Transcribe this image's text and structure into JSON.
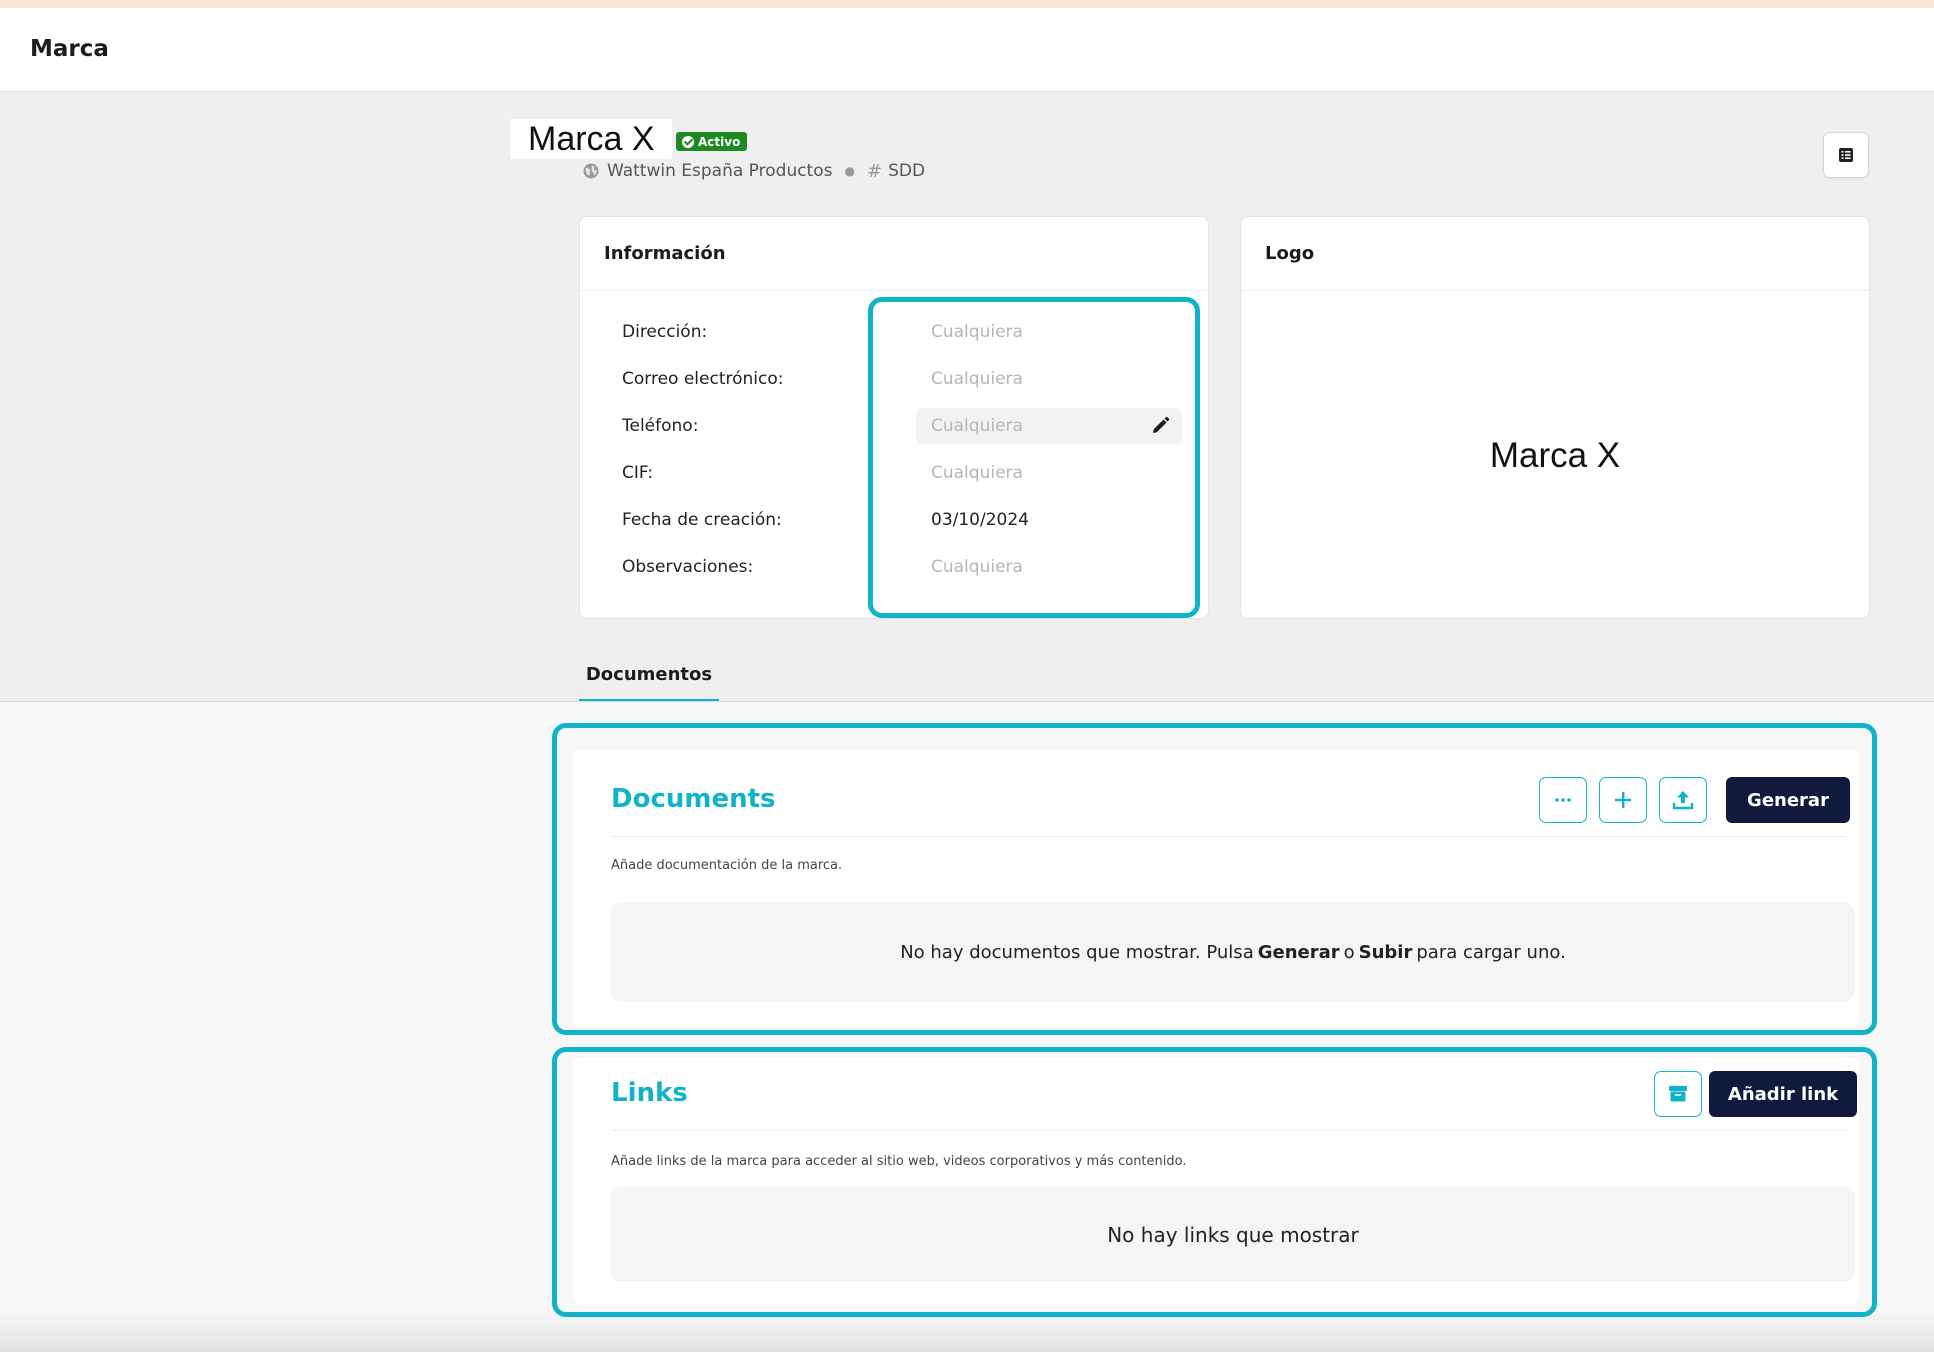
{
  "header": {
    "title": "Marca"
  },
  "brand": {
    "name": "Marca X",
    "status": "Activo",
    "organization": "Wattwin España Productos",
    "code": "SDD"
  },
  "info_card": {
    "title": "Información",
    "rows": [
      {
        "label": "Dirección:",
        "value": "Cualquiera"
      },
      {
        "label": "Correo electrónico:",
        "value": "Cualquiera"
      },
      {
        "label": "Teléfono:",
        "value": "Cualquiera"
      },
      {
        "label": "CIF:",
        "value": "Cualquiera"
      },
      {
        "label": "Fecha de creación:",
        "value": "03/10/2024"
      },
      {
        "label": "Observaciones:",
        "value": "Cualquiera"
      }
    ]
  },
  "logo_card": {
    "title": "Logo",
    "logo_text": "Marca X"
  },
  "tabs": [
    {
      "label": "Documentos"
    }
  ],
  "documents": {
    "title": "Documents",
    "description": "Añade documentación de la marca.",
    "generate_label": "Generar",
    "empty": {
      "pre": "No hay documentos que mostrar. Pulsa",
      "generate": "Generar",
      "or": "o",
      "upload": "Subir",
      "post": "para cargar uno."
    }
  },
  "links": {
    "title": "Links",
    "description": "Añade links de la marca para acceder al sitio web, videos corporativos y más contenido.",
    "add_label": "Añadir link",
    "empty": "No hay links que mostrar"
  },
  "icons": {
    "status": "check-circle-icon",
    "organization": "globe-icon",
    "code": "hash-icon",
    "toggle": "list-icon",
    "edit": "pencil-icon",
    "more": "ellipsis-icon",
    "add": "plus-icon",
    "upload": "upload-icon",
    "archive": "archive-icon"
  },
  "colors": {
    "accent": "#10b3c8",
    "primary_button": "#111a3d",
    "status_badge": "#1f8a24"
  }
}
